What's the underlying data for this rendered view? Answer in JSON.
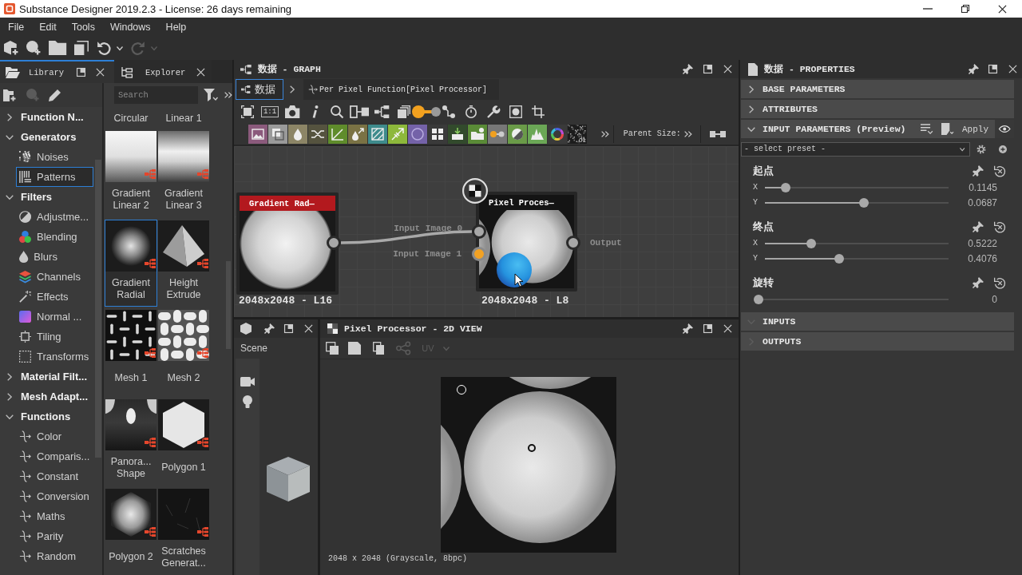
{
  "window": {
    "title": "Substance Designer 2019.2.3 - License: 26 days remaining"
  },
  "menu": [
    "File",
    "Edit",
    "Tools",
    "Windows",
    "Help"
  ],
  "toolbar": [
    {
      "disabled": false
    },
    {
      "disabled": false
    },
    {
      "disabled": false
    },
    {
      "disabled": false
    },
    {
      "disabled": false
    },
    {
      "disabled": true
    }
  ],
  "library": {
    "tabs": [
      {
        "label": "Library",
        "selected": true
      },
      {
        "label": "Explorer",
        "selected": false
      }
    ],
    "toolbar": [
      {
        "disabled": false
      },
      {
        "disabled": true
      },
      {
        "disabled": false
      }
    ],
    "search": {
      "placeholder": "Search"
    },
    "tree": [
      {
        "label": "Function N...",
        "expanded": false
      },
      {
        "label": "Generators",
        "expanded": true,
        "children": [
          {
            "label": "Noises",
            "selected": false
          },
          {
            "label": "Patterns",
            "selected": true
          }
        ]
      },
      {
        "label": "Filters",
        "expanded": true,
        "children": [
          {
            "label": "Adjustme...",
            "selected": false
          },
          {
            "label": "Blending",
            "selected": false
          },
          {
            "label": "Blurs",
            "selected": false
          },
          {
            "label": "Channels",
            "selected": false
          },
          {
            "label": "Effects",
            "selected": false
          },
          {
            "label": "Normal ...",
            "selected": false
          },
          {
            "label": "Tiling",
            "selected": false
          },
          {
            "label": "Transforms",
            "selected": false
          }
        ]
      },
      {
        "label": "Material Filt...",
        "expanded": false
      },
      {
        "label": "Mesh Adapt...",
        "expanded": false
      },
      {
        "label": "Functions",
        "expanded": true,
        "children": [
          {
            "label": "Color",
            "selected": false
          },
          {
            "label": "Comparis...",
            "selected": false
          },
          {
            "label": "Constant",
            "selected": false
          },
          {
            "label": "Conversion",
            "selected": false
          },
          {
            "label": "Maths",
            "selected": false
          },
          {
            "label": "Parity",
            "selected": false
          },
          {
            "label": "Random",
            "selected": false
          }
        ]
      }
    ],
    "thumbnails": [
      {
        "label": "Circular",
        "selected": false
      },
      {
        "label": "Linear 1",
        "selected": false
      },
      {
        "label": "Gradient Linear 2",
        "selected": false
      },
      {
        "label": "Gradient Linear 3",
        "selected": false
      },
      {
        "label": "Gradient Radial",
        "selected": true
      },
      {
        "label": "Height Extrude",
        "selected": false
      },
      {
        "label": "Mesh 1",
        "selected": false
      },
      {
        "label": "Mesh 2",
        "selected": false
      },
      {
        "label": "Panora... Shape",
        "selected": false
      },
      {
        "label": "Polygon 1",
        "selected": false
      },
      {
        "label": "Polygon 2",
        "selected": false
      },
      {
        "label": "Scratches Generat...",
        "selected": false
      }
    ]
  },
  "graph": {
    "title": "数据 - GRAPH",
    "breadcrumb": [
      {
        "label": "数据",
        "selected": true
      },
      {
        "label": "Per Pixel Function[Pixel Processor]",
        "selected": false
      }
    ],
    "actual_size_label": "1:1",
    "noise_badge": "01",
    "parent_size": "Parent Size:",
    "nodes": [
      {
        "title": "Gradient Rad—",
        "color": "#b3191e",
        "info": "2048x2048 - L16"
      },
      {
        "title": "Pixel Proces—",
        "info": "2048x2048 - L8",
        "inputs": [
          {
            "label": "Input Image 0",
            "selected": false
          },
          {
            "label": "Input Image 1",
            "selected": true
          }
        ],
        "output": "Output"
      }
    ]
  },
  "scene": {
    "tab": "Scene"
  },
  "view2d": {
    "title": "Pixel Processor - 2D VIEW",
    "toolbar": [
      {
        "disabled": false
      },
      {
        "disabled": false
      },
      {
        "disabled": false
      },
      {
        "disabled": true
      }
    ],
    "uv": {
      "label": "UV",
      "disabled": true
    },
    "status": "2048 x 2048 (Grayscale, 8bpc)"
  },
  "properties": {
    "title": "数据 - PROPERTIES",
    "sections": [
      {
        "title": "BASE PARAMETERS",
        "expanded": false,
        "empty": false
      },
      {
        "title": "ATTRIBUTES",
        "expanded": false,
        "empty": false
      },
      {
        "title": "INPUT PARAMETERS (Preview)",
        "expanded": true,
        "empty": false,
        "apply": "Apply",
        "preset": "- select preset -",
        "parameters": [
          {
            "label": "起点",
            "sliders": [
              {
                "axis": "X",
                "level": 0.113,
                "reading": "0.1145"
              },
              {
                "axis": "Y",
                "level": 0.537,
                "reading": "0.0687"
              }
            ]
          },
          {
            "label": "终点",
            "sliders": [
              {
                "axis": "X",
                "level": 0.253,
                "reading": "0.5222"
              },
              {
                "axis": "Y",
                "level": 0.406,
                "reading": "0.4076"
              }
            ]
          },
          {
            "label": "旋转",
            "sliders": [
              {
                "level": 0,
                "reading": "0"
              }
            ]
          }
        ]
      },
      {
        "title": "INPUTS",
        "expanded": true,
        "empty": true
      },
      {
        "title": "OUTPUTS",
        "expanded": false,
        "empty": true
      }
    ]
  }
}
